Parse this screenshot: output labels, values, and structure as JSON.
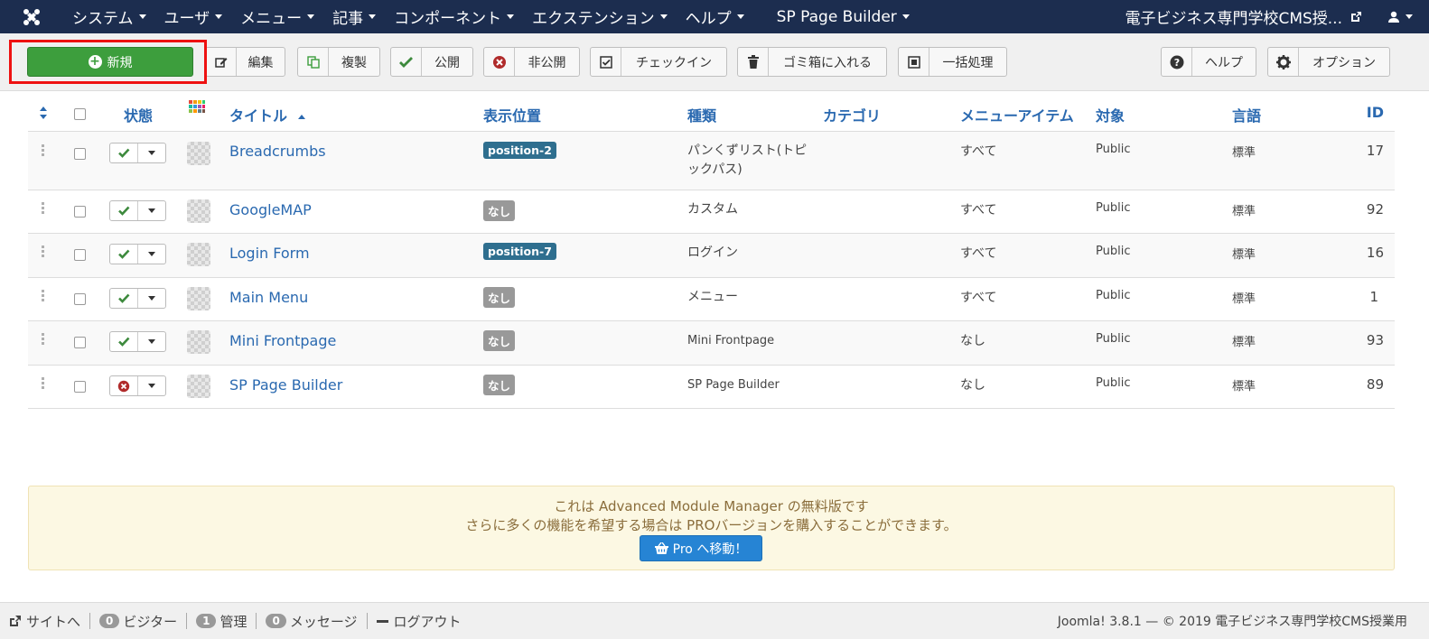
{
  "nav": {
    "items": [
      "システム",
      "ユーザ",
      "メニュー",
      "記事",
      "コンポーネント",
      "エクステンション",
      "ヘルプ",
      "SP Page Builder"
    ],
    "site_name": "電子ビジネス専門学校CMS授..."
  },
  "toolbar": {
    "new_label": "新規",
    "edit_label": "編集",
    "copy_label": "複製",
    "publish_label": "公開",
    "unpublish_label": "非公開",
    "checkin_label": "チェックイン",
    "trash_label": "ゴミ箱に入れる",
    "batch_label": "一括処理",
    "help_label": "ヘルプ",
    "options_label": "オプション"
  },
  "table": {
    "headers": {
      "status": "状態",
      "title": "タイトル",
      "position": "表示位置",
      "type": "種類",
      "category": "カテゴリ",
      "menuitem": "メニューアイテム",
      "access": "対象",
      "language": "言語",
      "id": "ID"
    },
    "rows": [
      {
        "title": "Breadcrumbs",
        "position": "position-2",
        "type": "パンくずリスト(トピックパス)",
        "menuitem": "すべて",
        "access": "Public",
        "language": "標準",
        "id": "17"
      },
      {
        "title": "GoogleMAP",
        "position": "なし",
        "type": "カスタム",
        "menuitem": "すべて",
        "access": "Public",
        "language": "標準",
        "id": "92"
      },
      {
        "title": "Login Form",
        "position": "position-7",
        "type": "ログイン",
        "menuitem": "すべて",
        "access": "Public",
        "language": "標準",
        "id": "16"
      },
      {
        "title": "Main Menu",
        "position": "なし",
        "type": "メニュー",
        "menuitem": "すべて",
        "access": "Public",
        "language": "標準",
        "id": "1"
      },
      {
        "title": "Mini Frontpage",
        "position": "なし",
        "type": "Mini Frontpage",
        "menuitem": "なし",
        "access": "Public",
        "language": "標準",
        "id": "93"
      },
      {
        "title": "SP Page Builder",
        "position": "なし",
        "type": "SP Page Builder",
        "menuitem": "なし",
        "access": "Public",
        "language": "標準",
        "id": "89"
      }
    ]
  },
  "notice": {
    "line1": "これは Advanced Module Manager の無料版です",
    "line2": "さらに多くの機能を希望する場合は PROバージョンを購入することができます。",
    "pro_button": "Pro へ移動！"
  },
  "footer": {
    "site_link": "サイトへ",
    "visitors_count": "0",
    "visitors_label": "ビジター",
    "admins_count": "1",
    "admins_label": "管理",
    "messages_count": "0",
    "messages_label": "メッセージ",
    "logout_label": "ログアウト",
    "copyright": "Joomla! 3.8.1 — © 2019 電子ビジネス専門学校CMS授業用"
  },
  "colors": {
    "navbar": "#1c2d4f",
    "new_button": "#3d9e3d",
    "link": "#2a69b0",
    "highlight": "#ee1111",
    "notice_bg": "#fcf8e3",
    "pro_button": "#2684d4"
  }
}
